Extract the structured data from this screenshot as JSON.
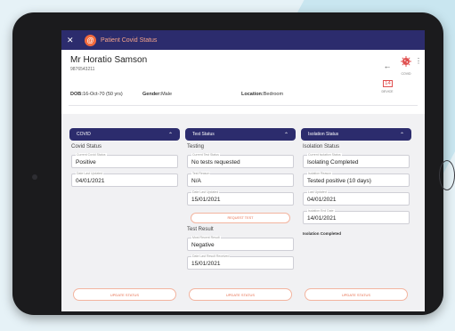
{
  "header": {
    "close_glyph": "✕",
    "logo_glyph": "@",
    "title": "Patient Covid Status"
  },
  "patient": {
    "name": "Mr Horatio Samson",
    "id": "9876543211",
    "dob_label": "DOB:",
    "dob_value": "16-Oct-70 (50 yrs)",
    "gender_label": "Gender:",
    "gender_value": "Male",
    "location_label": "Location:",
    "location_value": "Bedroom",
    "device_count": "14",
    "device_label": "DEVICE",
    "covid_label": "COVID",
    "more_glyph": "⋮"
  },
  "covid": {
    "header": "COVID",
    "subtitle": "Covid Status",
    "fields": [
      {
        "label": "Current Covid Status",
        "value": "Positive"
      },
      {
        "label": "Date Last Updated",
        "value": "04/01/2021"
      }
    ],
    "update_label": "UPDATE STATUS"
  },
  "test": {
    "header": "Test Status",
    "subtitle": "Testing",
    "fields": [
      {
        "label": "Current Test Status",
        "value": "No tests requested"
      },
      {
        "label": "Test Reason",
        "value": "N/A"
      },
      {
        "label": "Date Last Updated",
        "value": "15/01/2021"
      }
    ],
    "request_label": "REQUEST TEST",
    "result_subtitle": "Test Result",
    "result_fields": [
      {
        "label": "Most Recent Result",
        "value": "Negative"
      },
      {
        "label": "Date Last Result Received",
        "value": "15/01/2021"
      }
    ],
    "update_label": "UPDATE STATUS"
  },
  "isolation": {
    "header": "Isolation Status",
    "subtitle": "Isolation Status",
    "fields": [
      {
        "label": "Current Isolation Status",
        "value": "Isolating Completed"
      },
      {
        "label": "Isolation Reason",
        "value": "Tested positive (10 days)"
      },
      {
        "label": "Last Updated",
        "value": "04/01/2021"
      },
      {
        "label": "Isolation End Date",
        "value": "14/01/2021"
      }
    ],
    "note": "Isolation Completed",
    "update_label": "UPDATE STATUS"
  },
  "colors": {
    "navy": "#2c2c6d",
    "accent": "#f26a3d",
    "alert": "#e05050"
  }
}
